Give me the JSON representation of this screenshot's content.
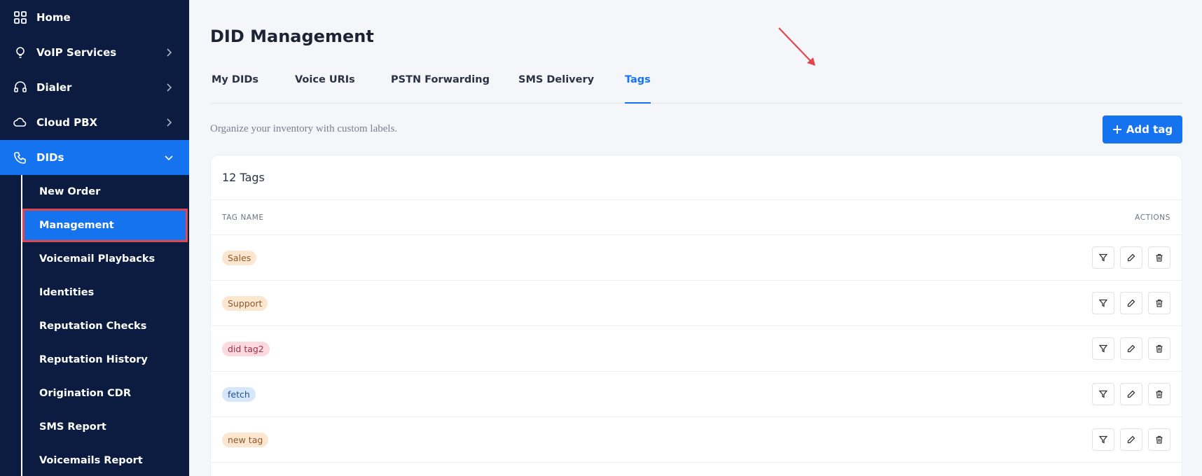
{
  "sidebar": {
    "items": [
      {
        "label": "Home",
        "icon": "grid-icon"
      },
      {
        "label": "VoIP Services",
        "icon": "lightbulb-icon"
      },
      {
        "label": "Dialer",
        "icon": "headset-icon"
      },
      {
        "label": "Cloud PBX",
        "icon": "cloud-icon"
      },
      {
        "label": "DIDs",
        "icon": "phone-icon"
      }
    ],
    "sub_items": [
      "New Order",
      "Management",
      "Voicemail Playbacks",
      "Identities",
      "Reputation Checks",
      "Reputation History",
      "Origination CDR",
      "SMS Report",
      "Voicemails Report"
    ]
  },
  "main": {
    "title": "DID Management",
    "tabs": [
      "My DIDs",
      "Voice URIs",
      "PSTN Forwarding",
      "SMS Delivery",
      "Tags"
    ],
    "active_tab": "Tags",
    "subtitle": "Organize your inventory with custom labels.",
    "add_button": "Add tag",
    "card_title": "12 Tags",
    "columns": {
      "name": "TAG NAME",
      "actions": "ACTIONS"
    },
    "tags": [
      {
        "name": "Sales",
        "bg": "#fde6cf",
        "fg": "#8a5a2b"
      },
      {
        "name": "Support",
        "bg": "#fde6cf",
        "fg": "#8a5a2b"
      },
      {
        "name": "did tag2",
        "bg": "#fbd9df",
        "fg": "#9a3346"
      },
      {
        "name": "fetch",
        "bg": "#d6e6fb",
        "fg": "#24508f"
      },
      {
        "name": "new tag",
        "bg": "#fde6cf",
        "fg": "#8a5a2b"
      }
    ]
  },
  "colors": {
    "sidebar_bg": "#0b1c40",
    "accent": "#1573f0",
    "highlight_border": "#e0474d"
  }
}
